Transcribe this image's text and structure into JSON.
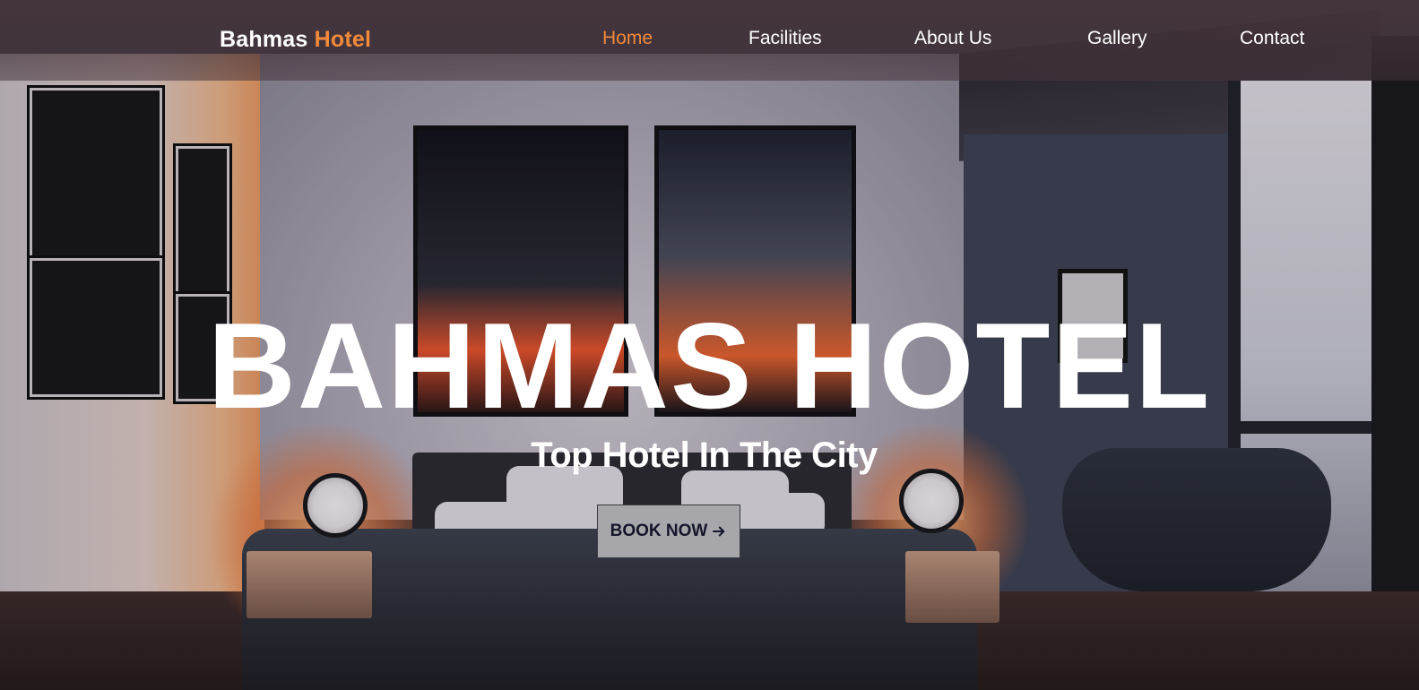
{
  "brand": {
    "name": "Bahmas",
    "accent": "Hotel",
    "accent_color": "#f28a3a"
  },
  "nav": {
    "items": [
      {
        "label": "Home",
        "active": true
      },
      {
        "label": "Facilities",
        "active": false
      },
      {
        "label": "About Us",
        "active": false
      },
      {
        "label": "Gallery",
        "active": false
      },
      {
        "label": "Contact",
        "active": false
      }
    ]
  },
  "hero": {
    "title": "BAHMAS HOTEL",
    "subtitle": "Top Hotel In The City",
    "cta_label": "BOOK NOW",
    "cta_icon": "arrow-right-icon"
  }
}
